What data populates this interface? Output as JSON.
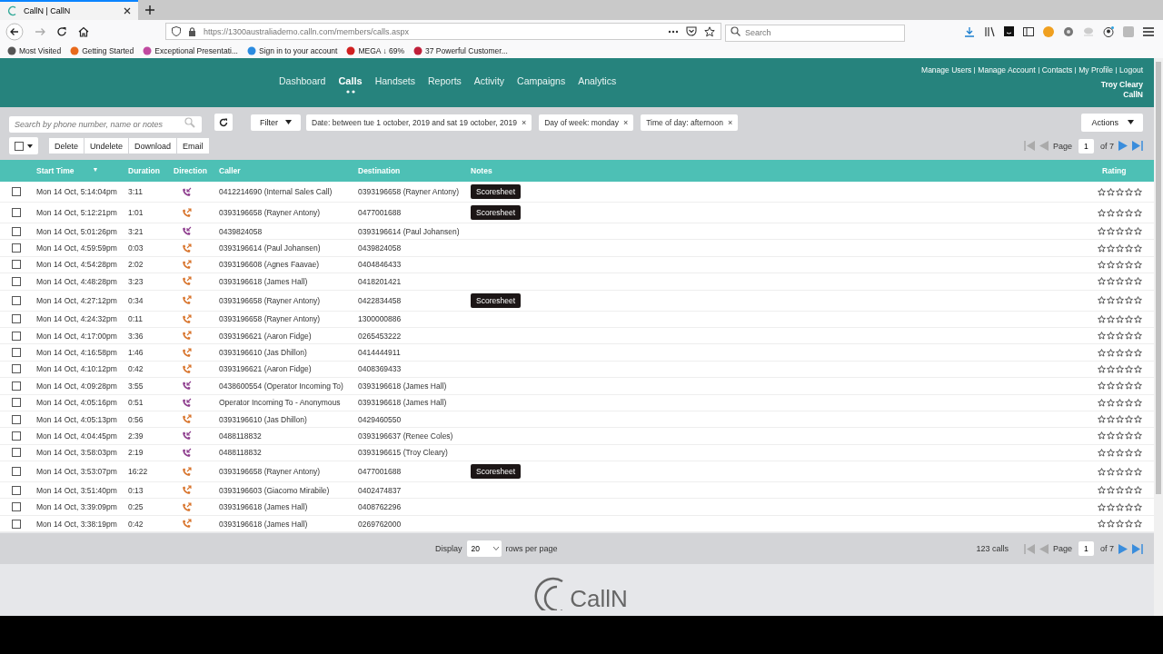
{
  "browser": {
    "tab_title": "CallN | CallN",
    "url": "https://1300australiademo.calln.com/members/calls.aspx",
    "search": {
      "placeholder": "Search"
    },
    "bookmarks": [
      "Most Visited",
      "Getting Started",
      "Exceptional Presentati...",
      "Sign in to your account",
      "MEGA ↓ 69%",
      "37 Powerful Customer..."
    ]
  },
  "header": {
    "nav": [
      {
        "label": "Dashboard",
        "selected": false
      },
      {
        "label": "Calls",
        "selected": true
      },
      {
        "label": "Handsets",
        "selected": false
      },
      {
        "label": "Reports",
        "selected": false
      },
      {
        "label": "Activity",
        "selected": false
      },
      {
        "label": "Campaigns",
        "selected": false
      },
      {
        "label": "Analytics",
        "selected": false
      }
    ],
    "links": [
      "Manage Users",
      "Manage Account",
      "Contacts",
      "My Profile",
      "Logout"
    ],
    "user": "Troy Cleary",
    "company": "CallN"
  },
  "toolbar": {
    "search": {
      "placeholder": "Search by phone number, name or notes"
    },
    "filter": "Filter",
    "chips": [
      "Date: between tue 1 october, 2019 and sat 19 october, 2019",
      "Day of week: monday",
      "Time of day: afternoon"
    ],
    "chip_close": "×",
    "actions": "Actions",
    "select_all": {
      "checked": false
    },
    "buttons": [
      "Delete",
      "Undelete",
      "Download",
      "Email"
    ],
    "pager": {
      "label": "Page",
      "page": "1",
      "of": "of 7"
    }
  },
  "table": {
    "columns": [
      "Start Time",
      "Duration",
      "Direction",
      "Caller",
      "Destination",
      "Notes",
      "Rating"
    ],
    "sort_mark": "▼",
    "rows": [
      {
        "checked": false,
        "start": "Mon 14 Oct, 5:14:04pm",
        "duration": "3:11",
        "kind": "incoming",
        "caller": "0412214690 (Internal Sales Call)",
        "destination": "0393196658 (Rayner Antony)",
        "note": "Scoresheet",
        "stars": 0
      },
      {
        "checked": false,
        "start": "Mon 14 Oct, 5:12:21pm",
        "duration": "1:01",
        "kind": "outgoing",
        "caller": "0393196658 (Rayner Antony)",
        "destination": "0477001688",
        "note": "Scoresheet",
        "stars": 0
      },
      {
        "checked": false,
        "start": "Mon 14 Oct, 5:01:26pm",
        "duration": "3:21",
        "kind": "incoming",
        "caller": "0439824058",
        "destination": "0393196614 (Paul Johansen)",
        "stars": 0
      },
      {
        "checked": false,
        "start": "Mon 14 Oct, 4:59:59pm",
        "duration": "0:03",
        "kind": "outgoing",
        "caller": "0393196614 (Paul Johansen)",
        "destination": "0439824058",
        "stars": 0
      },
      {
        "checked": false,
        "start": "Mon 14 Oct, 4:54:28pm",
        "duration": "2:02",
        "kind": "outgoing",
        "caller": "0393196608 (Agnes Faavae)",
        "destination": "0404846433",
        "stars": 0
      },
      {
        "checked": false,
        "start": "Mon 14 Oct, 4:48:28pm",
        "duration": "3:23",
        "kind": "outgoing",
        "caller": "0393196618 (James Hall)",
        "destination": "0418201421",
        "stars": 0
      },
      {
        "checked": false,
        "start": "Mon 14 Oct, 4:27:12pm",
        "duration": "0:34",
        "kind": "outgoing",
        "caller": "0393196658 (Rayner Antony)",
        "destination": "0422834458",
        "note": "Scoresheet",
        "stars": 0
      },
      {
        "checked": false,
        "start": "Mon 14 Oct, 4:24:32pm",
        "duration": "0:11",
        "kind": "outgoing",
        "caller": "0393196658 (Rayner Antony)",
        "destination": "1300000886",
        "stars": 0
      },
      {
        "checked": false,
        "start": "Mon 14 Oct, 4:17:00pm",
        "duration": "3:36",
        "kind": "outgoing",
        "caller": "0393196621 (Aaron Fidge)",
        "destination": "0265453222",
        "stars": 0
      },
      {
        "checked": false,
        "start": "Mon 14 Oct, 4:16:58pm",
        "duration": "1:46",
        "kind": "outgoing",
        "caller": "0393196610 (Jas Dhillon)",
        "destination": "0414444911",
        "stars": 0
      },
      {
        "checked": false,
        "start": "Mon 14 Oct, 4:10:12pm",
        "duration": "0:42",
        "kind": "outgoing",
        "caller": "0393196621 (Aaron Fidge)",
        "destination": "0408369433",
        "stars": 0
      },
      {
        "checked": false,
        "start": "Mon 14 Oct, 4:09:28pm",
        "duration": "3:55",
        "kind": "incoming",
        "caller": "0438600554 (Operator Incoming To)",
        "destination": "0393196618 (James Hall)",
        "stars": 0
      },
      {
        "checked": false,
        "start": "Mon 14 Oct, 4:05:16pm",
        "duration": "0:51",
        "kind": "incoming",
        "caller": "Operator Incoming To - Anonymous",
        "destination": "0393196618 (James Hall)",
        "stars": 0
      },
      {
        "checked": false,
        "start": "Mon 14 Oct, 4:05:13pm",
        "duration": "0:56",
        "kind": "outgoing",
        "caller": "0393196610 (Jas Dhillon)",
        "destination": "0429460550",
        "stars": 0
      },
      {
        "checked": false,
        "start": "Mon 14 Oct, 4:04:45pm",
        "duration": "2:39",
        "kind": "incoming",
        "caller": "0488118832",
        "destination": "0393196637 (Renee Coles)",
        "stars": 0
      },
      {
        "checked": false,
        "start": "Mon 14 Oct, 3:58:03pm",
        "duration": "2:19",
        "kind": "incoming",
        "caller": "0488118832",
        "destination": "0393196615 (Troy Cleary)",
        "stars": 0
      },
      {
        "checked": false,
        "start": "Mon 14 Oct, 3:53:07pm",
        "duration": "16:22",
        "kind": "outgoing",
        "caller": "0393196658 (Rayner Antony)",
        "destination": "0477001688",
        "note": "Scoresheet",
        "stars": 0
      },
      {
        "checked": false,
        "start": "Mon 14 Oct, 3:51:40pm",
        "duration": "0:13",
        "kind": "outgoing",
        "caller": "0393196603 (Giacomo Mirabile)",
        "destination": "0402474837",
        "stars": 0
      },
      {
        "checked": false,
        "start": "Mon 14 Oct, 3:39:09pm",
        "duration": "0:25",
        "kind": "outgoing",
        "caller": "0393196618 (James Hall)",
        "destination": "0408762296",
        "stars": 0
      },
      {
        "checked": false,
        "start": "Mon 14 Oct, 3:38:19pm",
        "duration": "0:42",
        "kind": "outgoing",
        "caller": "0393196618 (James Hall)",
        "destination": "0269762000",
        "stars": 0
      }
    ]
  },
  "footer": {
    "display": "Display",
    "rows": "20",
    "rows_label": "rows per page",
    "count": "123 calls",
    "pager": {
      "label": "Page",
      "page": "1",
      "of": "of 7"
    }
  },
  "logo": "CallN"
}
